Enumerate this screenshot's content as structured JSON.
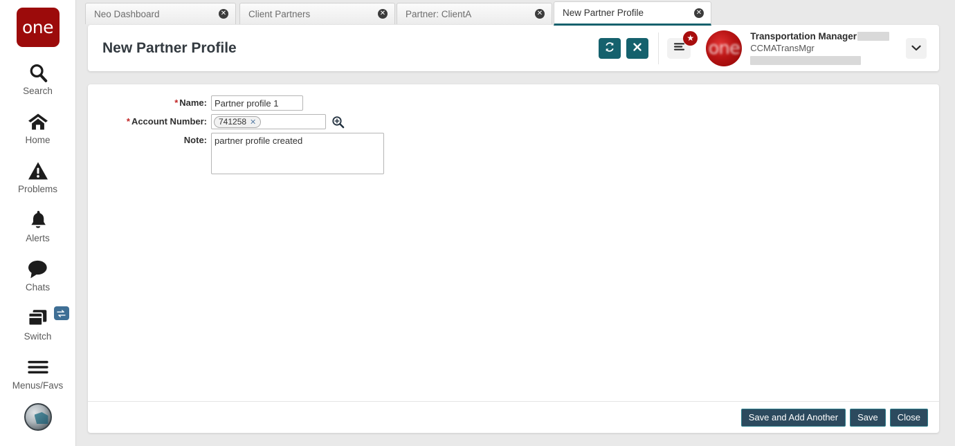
{
  "brand": {
    "logo_text": "one",
    "logo_color": "#9c0b0b"
  },
  "theme": {
    "accent_teal": "#15616d",
    "footer_button_bg": "#2c4a5e",
    "badge_red": "#a80d0d",
    "switch_badge_blue": "#3f6f95"
  },
  "sidebar": {
    "items": [
      {
        "label": "Search",
        "icon": "search-icon"
      },
      {
        "label": "Home",
        "icon": "home-icon"
      },
      {
        "label": "Problems",
        "icon": "warning-triangle-icon"
      },
      {
        "label": "Alerts",
        "icon": "bell-icon"
      },
      {
        "label": "Chats",
        "icon": "chat-bubble-icon"
      },
      {
        "label": "Switch",
        "icon": "switch-windows-icon",
        "badge_icon": "swap-arrows-icon"
      },
      {
        "label": "Menus/Favs",
        "icon": "hamburger-icon"
      }
    ],
    "assistant_avatar": "assistant-avatar-icon"
  },
  "tabs": [
    {
      "label": "Neo Dashboard",
      "active": false,
      "close_icon": "close-circle-icon"
    },
    {
      "label": "Client Partners",
      "active": false,
      "close_icon": "close-circle-icon"
    },
    {
      "label": "Partner: ClientA",
      "active": false,
      "close_icon": "close-circle-icon"
    },
    {
      "label": "New Partner Profile",
      "active": true,
      "close_icon": "close-circle-icon"
    }
  ],
  "header": {
    "title": "New Partner Profile",
    "refresh_icon": "refresh-icon",
    "close_icon": "close-x-icon",
    "menu_icon": "hamburger-menu-icon",
    "menu_badge_icon": "star-icon",
    "avatar_icon": "user-avatar",
    "user_name": "Transportation Manager",
    "user_id": "CCMATransMgr",
    "caret_icon": "chevron-down-icon"
  },
  "form": {
    "name": {
      "label": "Name:",
      "required": true,
      "value": "Partner profile 1"
    },
    "account_number": {
      "label": "Account Number:",
      "required": true,
      "chip_value": "741258",
      "chip_remove_icon": "close-x-icon",
      "lookup_icon": "magnifier-plus-icon"
    },
    "note": {
      "label": "Note:",
      "required": false,
      "value": "partner profile created"
    }
  },
  "footer": {
    "save_and_add_another": "Save and Add Another",
    "save": "Save",
    "close": "Close"
  }
}
